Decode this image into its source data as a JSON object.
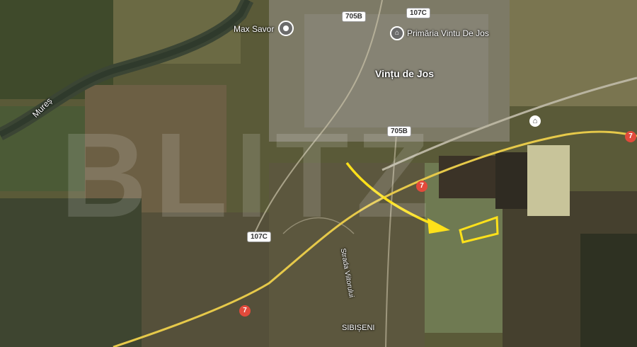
{
  "map": {
    "labels": {
      "town_center": "Vințu de Jos",
      "poi_shop": "Max Savor",
      "poi_townhall": "Primăria Vintu De Jos",
      "river": "Mureș",
      "street": "Strada Viitorului",
      "village_south": "SIBIȘENI"
    },
    "roads": {
      "r705b_top": "705B",
      "r107c_top": "107C",
      "r705b_mid": "705B",
      "r107c_mid": "107C",
      "r7_a": "7",
      "r7_b": "7",
      "r7_c": "7"
    },
    "watermark": "BLITZ",
    "colors": {
      "route": "#e6c94a",
      "highlight": "#ffe11a",
      "road_shield_red": "#e24a3b"
    },
    "icons": {
      "pin": "location-pin-icon",
      "townhall": "townhall-icon",
      "rail": "train-station-icon",
      "arrow": "arrow-icon"
    }
  }
}
